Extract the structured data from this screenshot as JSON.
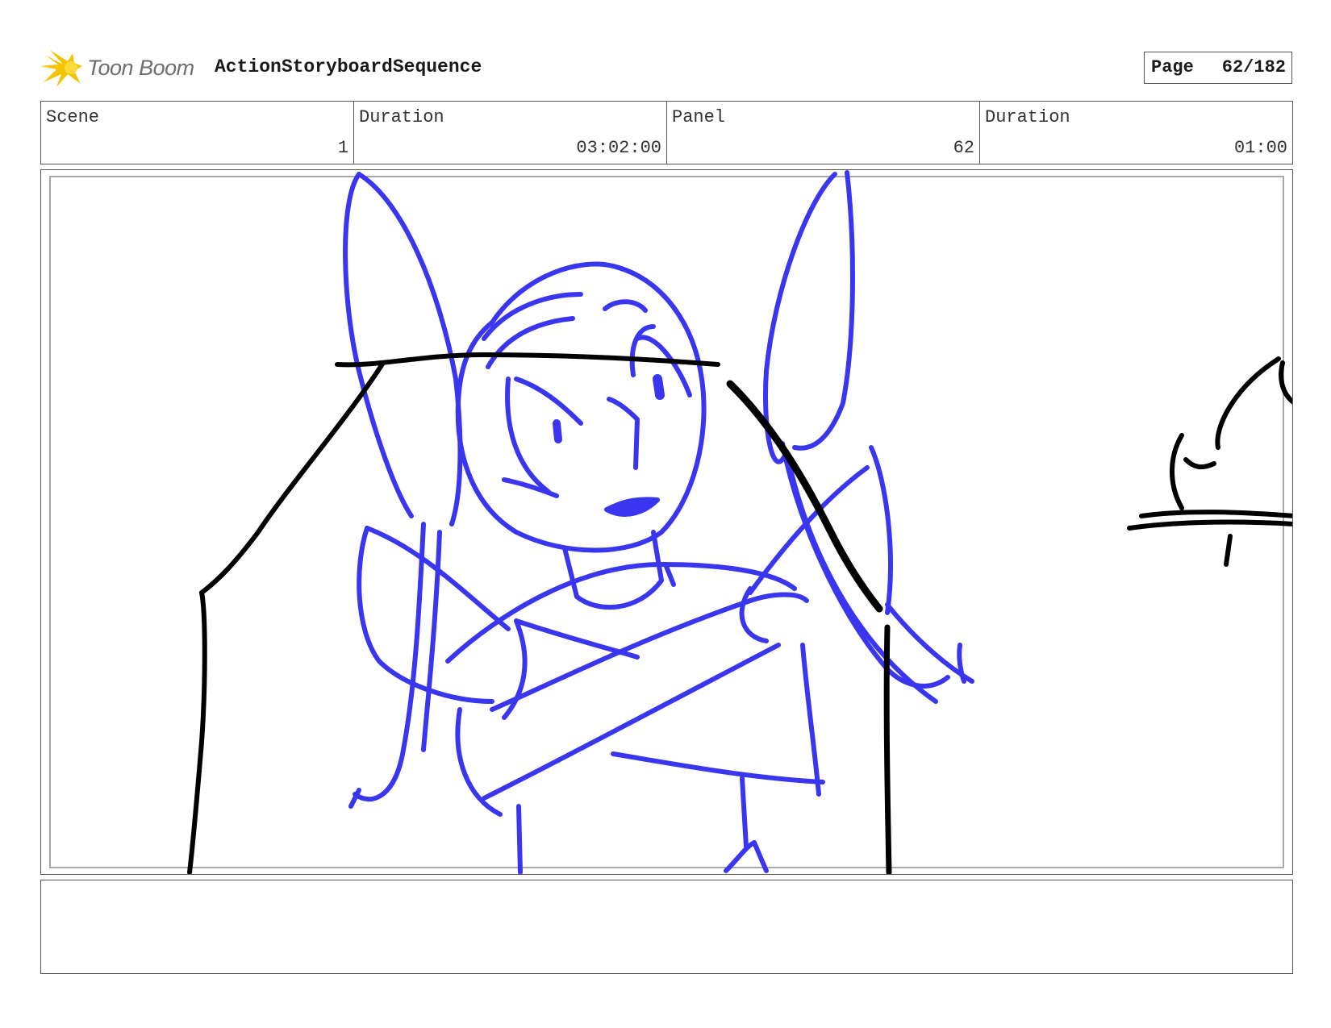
{
  "header": {
    "logo_text": "Toon Boom",
    "logo_icon": "toon-boom-starburst-icon",
    "project_title": "ActionStoryboardSequence",
    "page_label": "Page",
    "page_value": "62/182"
  },
  "info": {
    "scene_label": "Scene",
    "scene_value": "1",
    "scene_duration_label": "Duration",
    "scene_duration_value": "03:02:00",
    "panel_label": "Panel",
    "panel_value": "62",
    "panel_duration_label": "Duration",
    "panel_duration_value": "01:00"
  },
  "colors": {
    "sketch_blue": "#3a36ef",
    "sketch_black": "#000000",
    "logo_yellow": "#f5c400"
  },
  "notes": {
    "text": ""
  }
}
